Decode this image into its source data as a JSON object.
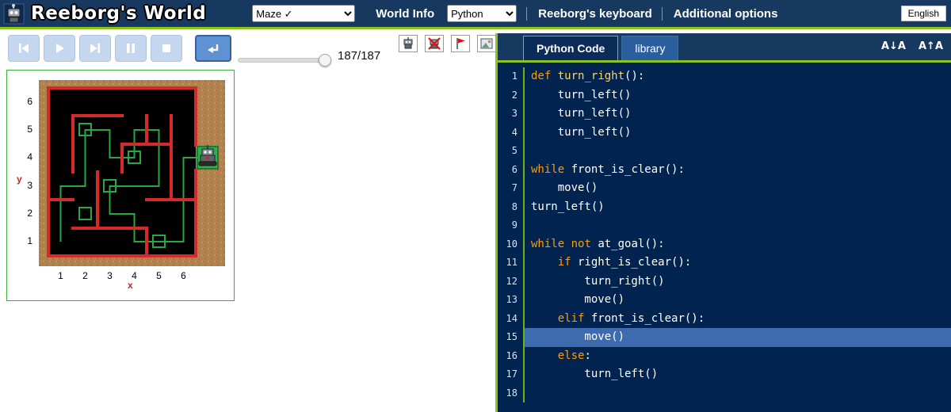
{
  "header": {
    "title": "Reeborg's World",
    "world_select_value": "Maze ✓",
    "world_info_label": "World Info",
    "language_select_value": "Python",
    "keyboard_label": "Reeborg's keyboard",
    "options_label": "Additional options",
    "ui_language_label": "English"
  },
  "toolbar": {
    "playback_icons": [
      "skip-to-start",
      "play",
      "skip-to-end",
      "pause",
      "stop"
    ],
    "step_icon": "enter-step",
    "slider": {
      "value": 187,
      "max": 187
    },
    "counter": "187/187",
    "world_icons": [
      "robot",
      "robot-removed",
      "red-flag",
      "background-image"
    ]
  },
  "world": {
    "y_axis_label": "y",
    "x_axis_label": "x",
    "y_labels": [
      "6",
      "5",
      "4",
      "3",
      "2",
      "1"
    ],
    "x_labels": [
      "1",
      "2",
      "3",
      "4",
      "5",
      "6"
    ],
    "colors": {
      "wall": "#d42a2a",
      "trail": "#27a844",
      "goal": "#2fae4a",
      "ground": "#000000",
      "border": "#b1824e"
    }
  },
  "editor": {
    "tabs": [
      {
        "label": "Python Code"
      },
      {
        "label": "library"
      }
    ],
    "active_tab": "Python Code",
    "font_decrease": "A↓A",
    "font_increase": "A↑A",
    "highlighted_line": 15,
    "colors": {
      "keyword": "#ff9d00",
      "function": "#ffd45e",
      "text": "#ffffff",
      "background": "#00244f",
      "highlight": "#3d6bb0"
    },
    "lines": [
      [
        [
          "k",
          "def"
        ],
        [
          "p",
          " "
        ],
        [
          "f",
          "turn_right"
        ],
        [
          "p",
          "():"
        ]
      ],
      [
        [
          "p",
          "    turn_left()"
        ]
      ],
      [
        [
          "p",
          "    turn_left()"
        ]
      ],
      [
        [
          "p",
          "    turn_left()"
        ]
      ],
      [],
      [
        [
          "k",
          "while"
        ],
        [
          "p",
          " front_is_clear():"
        ]
      ],
      [
        [
          "p",
          "    move()"
        ]
      ],
      [
        [
          "p",
          "turn_left()"
        ]
      ],
      [],
      [
        [
          "k",
          "while"
        ],
        [
          "p",
          " "
        ],
        [
          "k",
          "not"
        ],
        [
          "p",
          " at_goal():"
        ]
      ],
      [
        [
          "p",
          "    "
        ],
        [
          "k",
          "if"
        ],
        [
          "p",
          " right_is_clear():"
        ]
      ],
      [
        [
          "p",
          "        turn_right()"
        ]
      ],
      [
        [
          "p",
          "        move()"
        ]
      ],
      [
        [
          "p",
          "    "
        ],
        [
          "k",
          "elif"
        ],
        [
          "p",
          " front_is_clear():"
        ]
      ],
      [
        [
          "p",
          "        move()"
        ]
      ],
      [
        [
          "p",
          "    "
        ],
        [
          "k",
          "else"
        ],
        [
          "p",
          ":"
        ]
      ],
      [
        [
          "p",
          "        turn_left()"
        ]
      ],
      []
    ]
  }
}
